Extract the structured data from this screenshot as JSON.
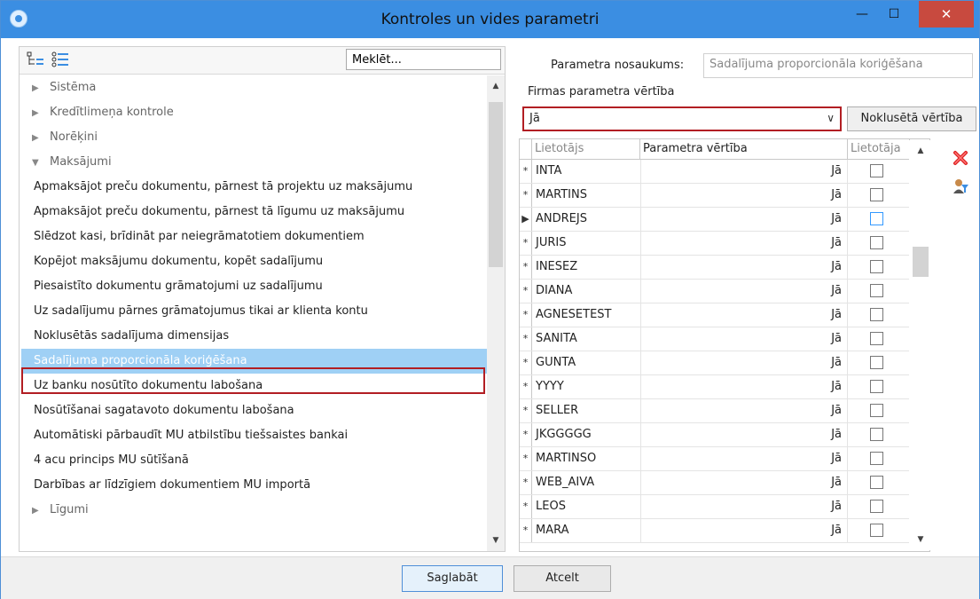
{
  "window": {
    "title": "Kontroles un vides parametri",
    "controls": {
      "minimize": "—",
      "maximize": "☐",
      "close": "✕"
    }
  },
  "left": {
    "search_placeholder": "Meklēt...",
    "tree": [
      {
        "label": "Sistēma",
        "type": "category",
        "arrow": "▶"
      },
      {
        "label": "Kredītlimeņa kontrole",
        "type": "category",
        "arrow": "▶"
      },
      {
        "label": "Norēķini",
        "type": "category",
        "arrow": "▶"
      },
      {
        "label": "Maksājumi",
        "type": "category",
        "arrow": "▼"
      },
      {
        "label": "Apmaksājot preču dokumentu, pārnest tā projektu uz maksājumu",
        "type": "item"
      },
      {
        "label": "Apmaksājot preču dokumentu, pārnest tā līgumu uz maksājumu",
        "type": "item"
      },
      {
        "label": "Slēdzot kasi, brīdināt par neiegrāmatotiem dokumentiem",
        "type": "item"
      },
      {
        "label": "Kopējot maksājumu dokumentu, kopēt sadalījumu",
        "type": "item"
      },
      {
        "label": "Piesaistīto dokumentu grāmatojumi uz sadalījumu",
        "type": "item"
      },
      {
        "label": "Uz sadalījumu pārnes grāmatojumus tikai ar klienta kontu",
        "type": "item"
      },
      {
        "label": "Noklusētās sadalījuma dimensijas",
        "type": "item"
      },
      {
        "label": "Sadalījuma proporcionāla koriģēšana",
        "type": "item",
        "selected": true
      },
      {
        "label": "Uz banku nosūtīto dokumentu labošana",
        "type": "item"
      },
      {
        "label": "Nosūtīšanai sagatavoto dokumentu labošana",
        "type": "item"
      },
      {
        "label": "Automātiski pārbaudīt MU atbilstību tiešsaistes bankai",
        "type": "item"
      },
      {
        "label": "4 acu princips MU sūtīšanā",
        "type": "item"
      },
      {
        "label": "Darbības ar līdzīgiem dokumentiem MU importā",
        "type": "item"
      },
      {
        "label": "Līgumi",
        "type": "category",
        "arrow": "▶"
      }
    ]
  },
  "right": {
    "param_name_label": "Parametra nosaukums:",
    "param_name_value": "Sadalījuma proporcionāla koriģēšana",
    "firm_value_label": "Firmas parametra vērtība",
    "firm_value": "Jā",
    "default_button": "Noklusētā vērtība",
    "grid": {
      "headers": {
        "user": "Lietotājs",
        "value": "Parametra vērtība",
        "user_flag": "Lietotāja"
      },
      "rows": [
        {
          "user": "INTA",
          "value": "Jā",
          "mark": "*"
        },
        {
          "user": "MARTINS",
          "value": "Jā",
          "mark": "*"
        },
        {
          "user": "ANDREJS",
          "value": "Jā",
          "mark": "▶",
          "current": true
        },
        {
          "user": "JURIS",
          "value": "Jā",
          "mark": "*"
        },
        {
          "user": "INESEZ",
          "value": "Jā",
          "mark": "*"
        },
        {
          "user": "DIANA",
          "value": "Jā",
          "mark": "*"
        },
        {
          "user": "AGNESETEST",
          "value": "Jā",
          "mark": "*"
        },
        {
          "user": "SANITA",
          "value": "Jā",
          "mark": "*"
        },
        {
          "user": "GUNTA",
          "value": "Jā",
          "mark": "*"
        },
        {
          "user": "YYYY",
          "value": "Jā",
          "mark": "*"
        },
        {
          "user": "SELLER",
          "value": "Jā",
          "mark": "*"
        },
        {
          "user": "JKGGGGG",
          "value": "Jā",
          "mark": "*"
        },
        {
          "user": "MARTINSO",
          "value": "Jā",
          "mark": "*"
        },
        {
          "user": "WEB_AIVA",
          "value": "Jā",
          "mark": "*"
        },
        {
          "user": "LEOS",
          "value": "Jā",
          "mark": "*"
        },
        {
          "user": "MARA",
          "value": "Jā",
          "mark": "*"
        }
      ]
    }
  },
  "buttons": {
    "save": "Saglabāt",
    "cancel": "Atcelt"
  },
  "colors": {
    "titlebar": "#3b8ee2",
    "close": "#c84a3f",
    "selection": "#9fd0f5",
    "highlight_border": "#b21e23"
  }
}
